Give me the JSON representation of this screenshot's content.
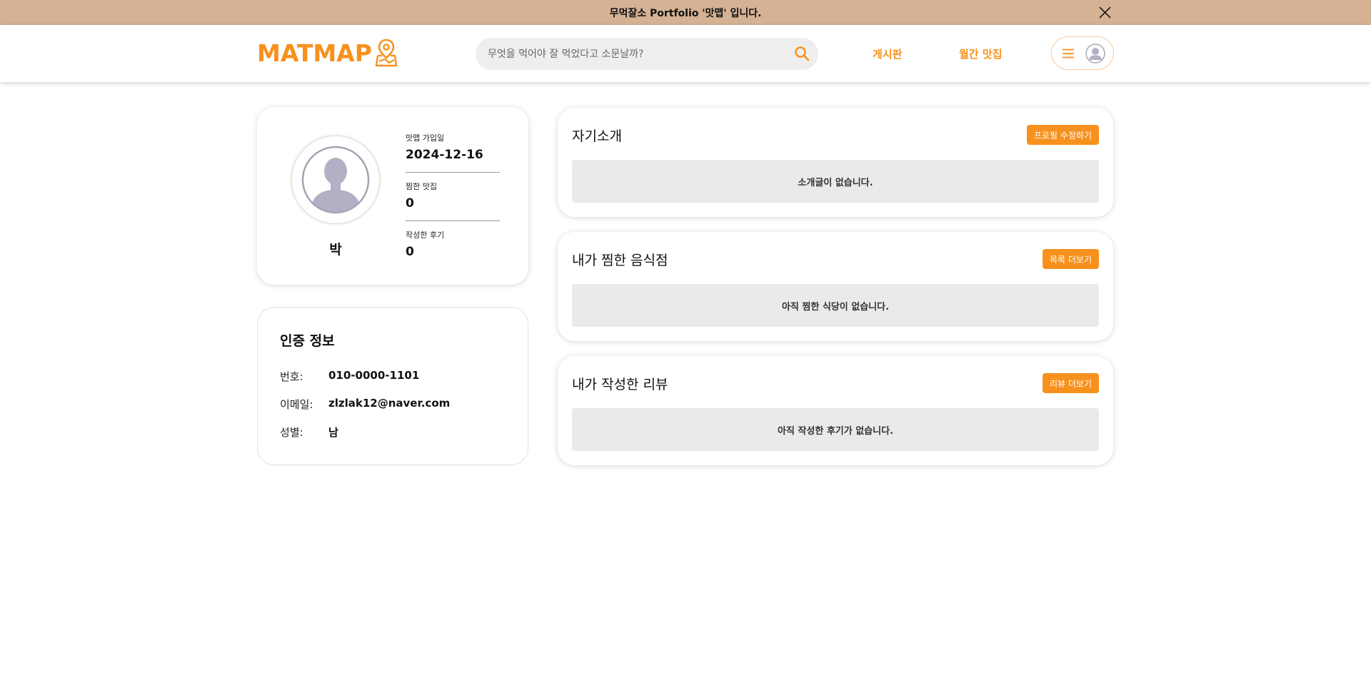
{
  "banner": {
    "text": "무먹잘소 Portfolio '맛맵' 입니다.",
    "close_icon": "close-icon"
  },
  "header": {
    "logo_text": "MATMAP",
    "logo_icon": "map-pin-icon",
    "search_placeholder": "무엇을 먹어야 잘 먹었다고 소문날까?",
    "nav": {
      "board": "게시판",
      "monthly": "월간 맛집"
    },
    "accent_color": "#f7911d"
  },
  "profile": {
    "name": "박",
    "stats": [
      {
        "label": "맛맵 가입일",
        "value": "2024-12-16"
      },
      {
        "label": "찜한 맛집",
        "value": "0"
      },
      {
        "label": "작성한 후기",
        "value": "0"
      }
    ]
  },
  "auth": {
    "title": "인증 정보",
    "rows": [
      {
        "label": "번호:",
        "value": "010-0000-1101"
      },
      {
        "label": "이메일:",
        "value": "zlzlak12@naver.com"
      },
      {
        "label": "성별:",
        "value": "남"
      }
    ]
  },
  "sections": [
    {
      "title": "자기소개",
      "button": "프로필 수정하기",
      "empty": "소개글이 없습니다."
    },
    {
      "title": "내가 찜한 음식점",
      "button": "목록 더보기",
      "empty": "아직 찜한 식당이 없습니다."
    },
    {
      "title": "내가 작성한 리뷰",
      "button": "리뷰 더보기",
      "empty": "아직 작성한 후기가 없습니다."
    }
  ]
}
